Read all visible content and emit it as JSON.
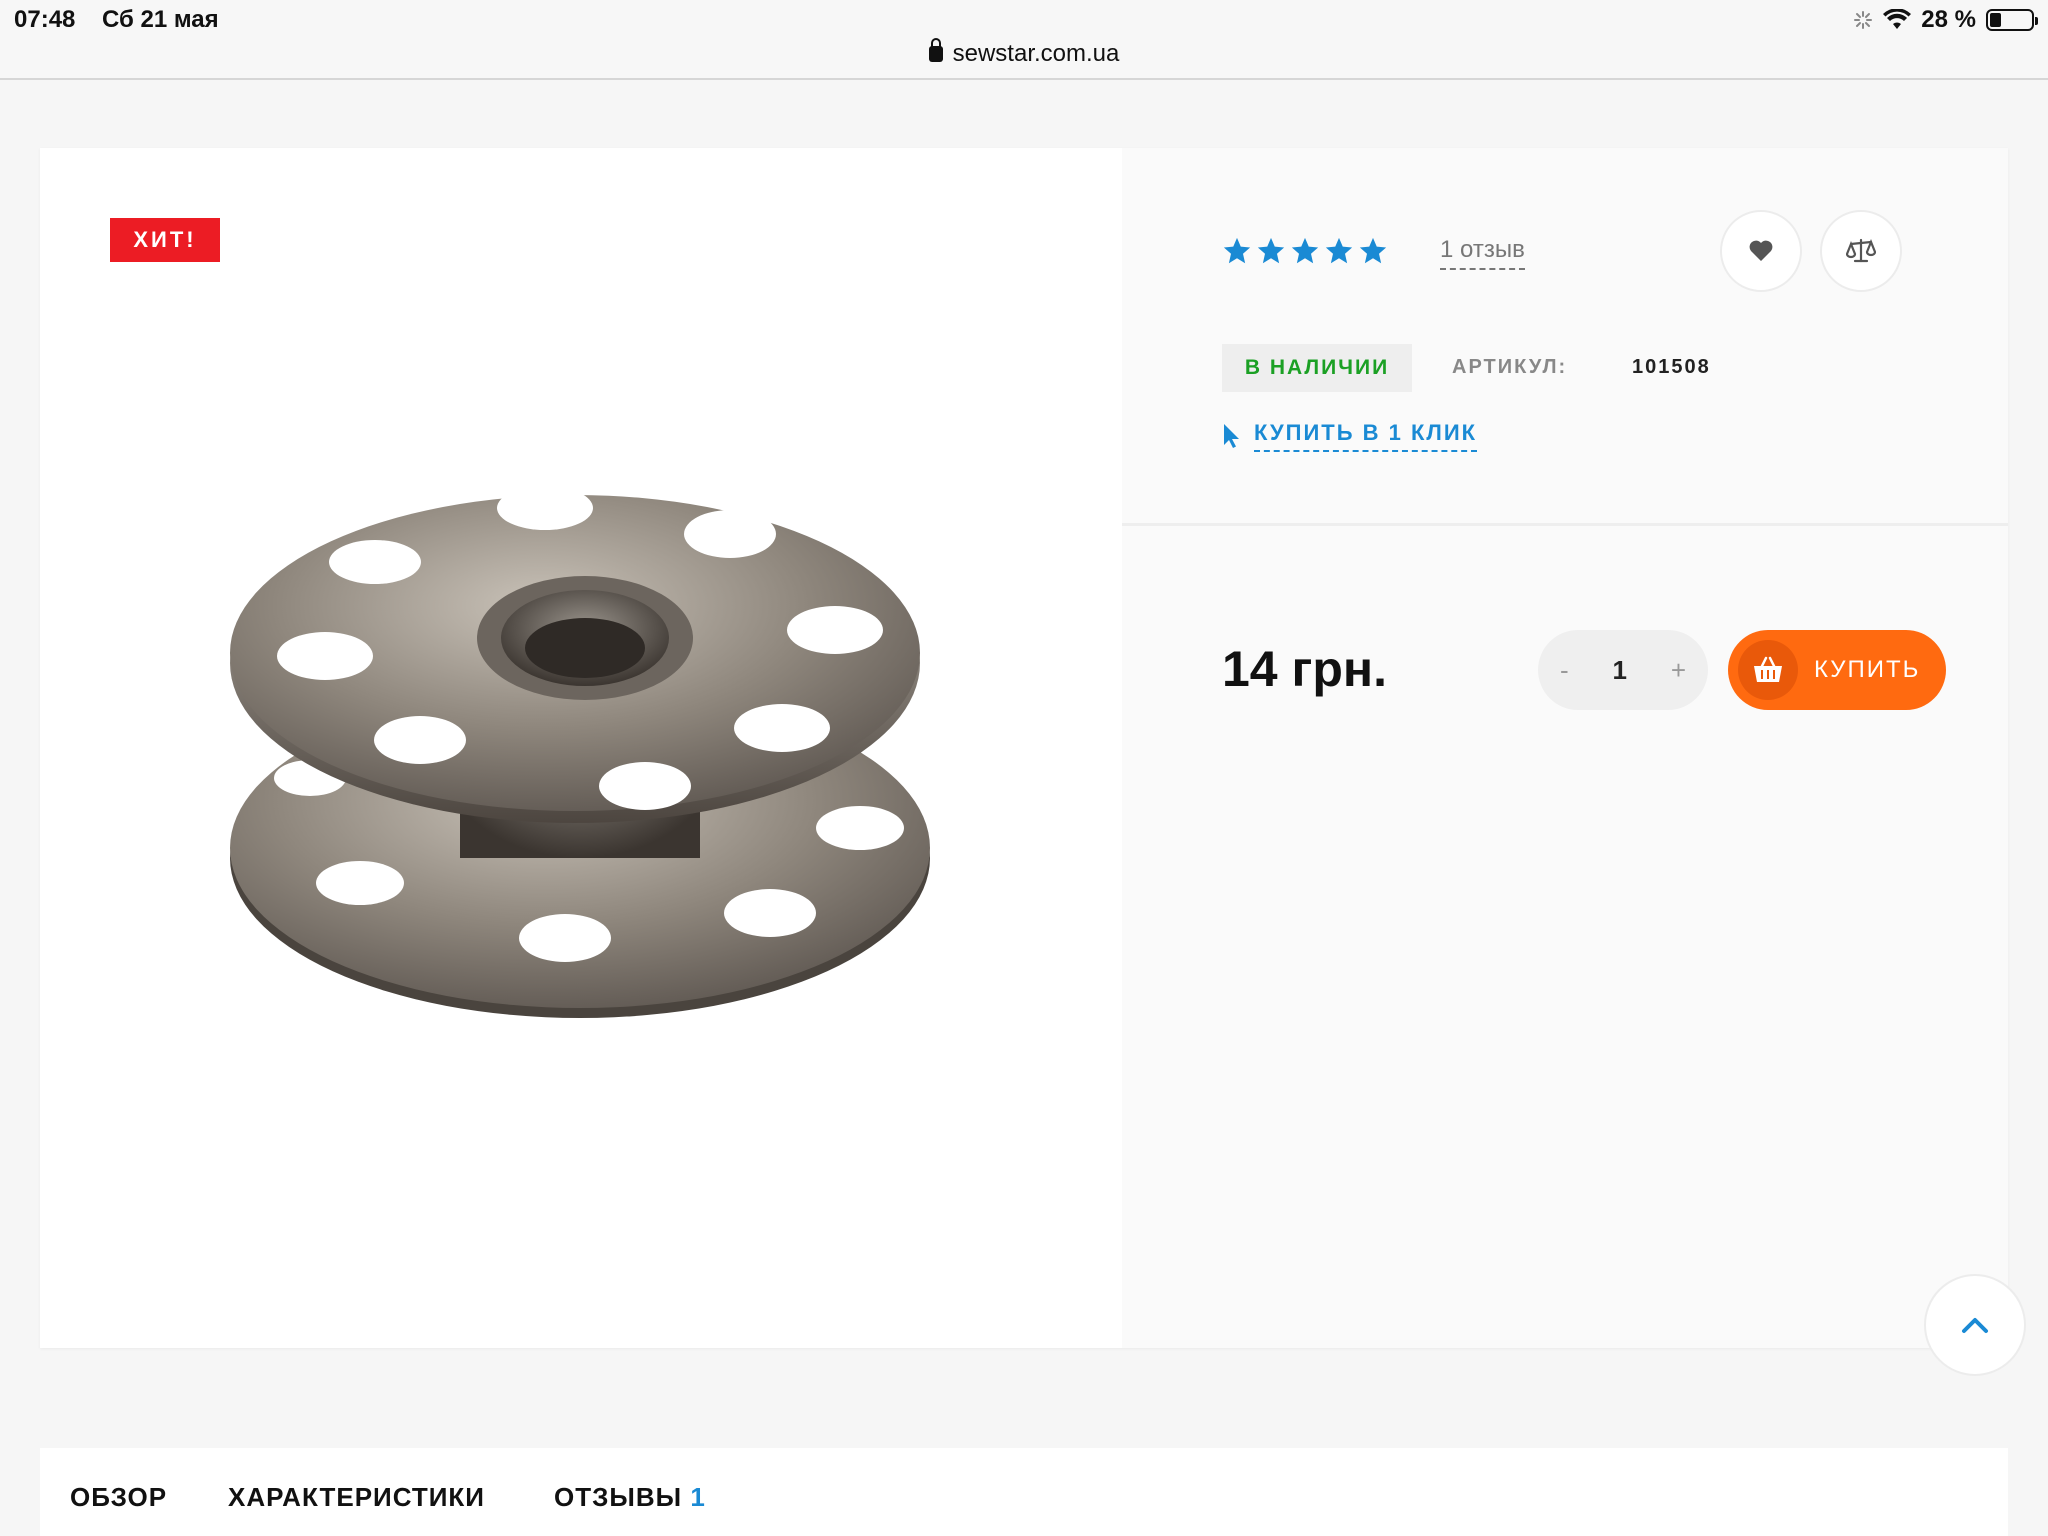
{
  "status_bar": {
    "time": "07:48",
    "date": "Сб 21 мая",
    "url": "sewstar.com.ua",
    "battery": "28 %",
    "battery_level_percent": 28
  },
  "product": {
    "badge": "ХИТ!",
    "image_alt": "metal bobbin",
    "rating_stars": 5,
    "reviews_link": "1 отзыв",
    "stock_status": "В НАЛИЧИИ",
    "sku_label": "АРТИКУЛ:",
    "sku_value": "101508",
    "one_click": "КУПИТЬ В 1 КЛИК",
    "price": "14 грн.",
    "quantity": "1",
    "qty_minus": "-",
    "qty_plus": "+",
    "buy_label": "КУПИТЬ"
  },
  "tabs": [
    {
      "label": "ОБЗОР"
    },
    {
      "label": "ХАРАКТЕРИСТИКИ"
    },
    {
      "label": "ОТЗЫВЫ",
      "count": "1"
    }
  ],
  "colors": {
    "accent_blue": "#1a8ad4",
    "buy_orange": "#ff6a10",
    "hit_red": "#ec1c24",
    "stock_green": "#1ba024"
  },
  "icons": {
    "favorite": "heart-icon",
    "compare": "scales-icon",
    "cart": "basket-icon",
    "scroll_top": "chevron-up-icon",
    "one_click": "cursor-icon"
  }
}
